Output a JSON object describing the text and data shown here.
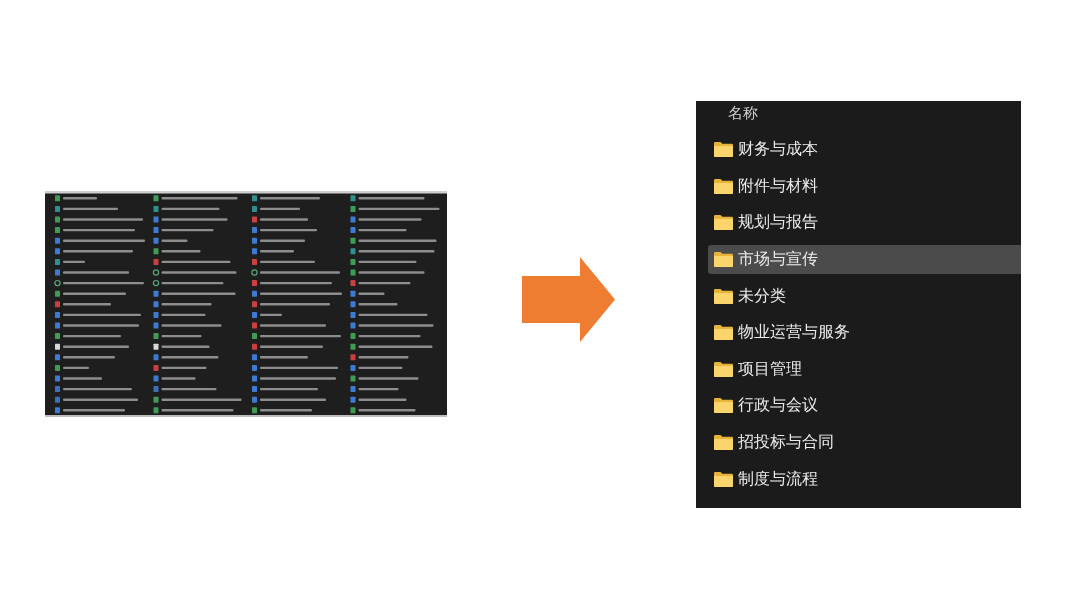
{
  "folder_panel": {
    "column_header": "名称",
    "folders": [
      {
        "name": "财务与成本",
        "selected": false
      },
      {
        "name": "附件与材料",
        "selected": false
      },
      {
        "name": "规划与报告",
        "selected": false
      },
      {
        "name": "市场与宣传",
        "selected": true
      },
      {
        "name": "未分类",
        "selected": false
      },
      {
        "name": "物业运营与服务",
        "selected": false
      },
      {
        "name": "项目管理",
        "selected": false
      },
      {
        "name": "行政与会议",
        "selected": false
      },
      {
        "name": "招投标与合同",
        "selected": false
      },
      {
        "name": "制度与流程",
        "selected": false
      }
    ]
  }
}
